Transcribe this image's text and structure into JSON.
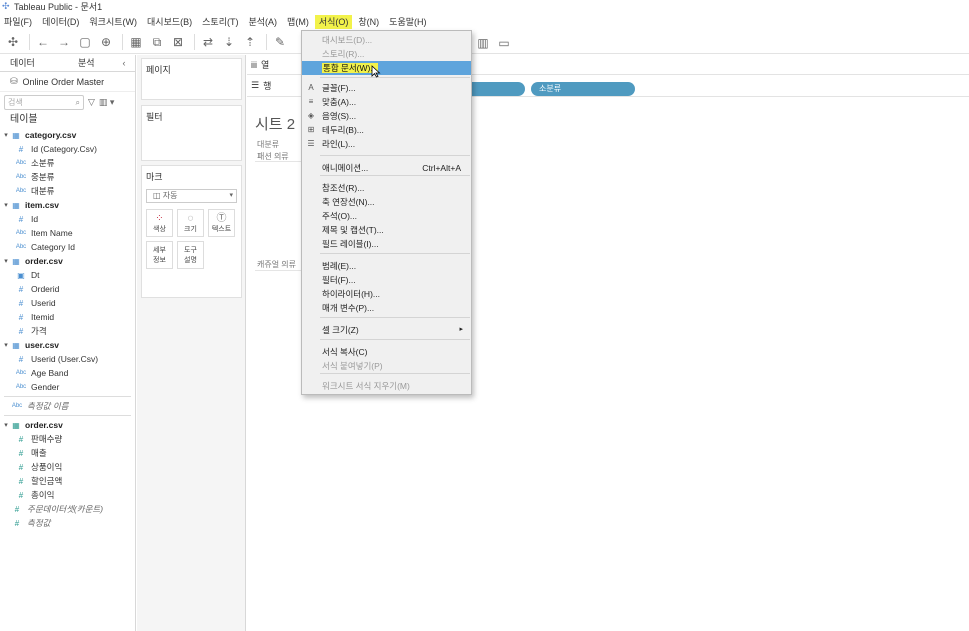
{
  "title": "Tableau Public - 문서1",
  "menus": [
    "파일(F)",
    "데이터(D)",
    "워크시트(W)",
    "대시보드(B)",
    "스토리(T)",
    "분석(A)",
    "맵(M)",
    "서식(O)",
    "창(N)",
    "도움말(H)"
  ],
  "left": {
    "tab_data": "데이터",
    "tab_analysis": "분석",
    "datasource": "Online Order Master",
    "search_placeholder": "검색",
    "tables_label": "테이블",
    "tree": [
      {
        "name": "category.csv",
        "level": 0,
        "type": "table"
      },
      {
        "name": "Id (Category.Csv)",
        "level": 1,
        "type": "num"
      },
      {
        "name": "소분류",
        "level": 1,
        "type": "abc"
      },
      {
        "name": "중분류",
        "level": 1,
        "type": "abc"
      },
      {
        "name": "대분류",
        "level": 1,
        "type": "abc"
      },
      {
        "name": "item.csv",
        "level": 0,
        "type": "table"
      },
      {
        "name": "Id",
        "level": 1,
        "type": "num"
      },
      {
        "name": "Item Name",
        "level": 1,
        "type": "abc"
      },
      {
        "name": "Category Id",
        "level": 1,
        "type": "abc"
      },
      {
        "name": "order.csv",
        "level": 0,
        "type": "table"
      },
      {
        "name": "Dt",
        "level": 1,
        "type": "cal"
      },
      {
        "name": "Orderid",
        "level": 1,
        "type": "num"
      },
      {
        "name": "Userid",
        "level": 1,
        "type": "num"
      },
      {
        "name": "Itemid",
        "level": 1,
        "type": "num"
      },
      {
        "name": "가격",
        "level": 1,
        "type": "num"
      },
      {
        "name": "user.csv",
        "level": 0,
        "type": "table"
      },
      {
        "name": "Userid (User.Csv)",
        "level": 1,
        "type": "num"
      },
      {
        "name": "Age Band",
        "level": 1,
        "type": "abc"
      },
      {
        "name": "Gender",
        "level": 1,
        "type": "abc"
      },
      {
        "name": "측정값 이름",
        "level": 0,
        "type": "abc-italic"
      },
      {
        "name": "order.csv",
        "level": 0,
        "type": "measure-table"
      },
      {
        "name": "판매수량",
        "level": 1,
        "type": "measure"
      },
      {
        "name": "매출",
        "level": 1,
        "type": "measure"
      },
      {
        "name": "상품이익",
        "level": 1,
        "type": "measure"
      },
      {
        "name": "할인금액",
        "level": 1,
        "type": "measure"
      },
      {
        "name": "총이익",
        "level": 1,
        "type": "measure"
      },
      {
        "name": "주문데이터셋(카운트)",
        "level": 0,
        "type": "measure-italic"
      },
      {
        "name": "측정값",
        "level": 0,
        "type": "measure-italic"
      }
    ]
  },
  "mid": {
    "pages": "페이지",
    "filters": "필터",
    "marks": "마크",
    "mark_type": "자동",
    "btn_color": "색상",
    "btn_size": "크기",
    "btn_text": "텍스트",
    "btn_detail_1": "세부",
    "btn_detail_2": "정보",
    "btn_tooltip_1": "도구",
    "btn_tooltip_2": "설명"
  },
  "canvas": {
    "columns_label": "열",
    "rows_label": "행",
    "row_pill": "소분류",
    "sheet_title": "시트 2",
    "hdr1": "대분류",
    "hdr2": "패션 의류",
    "hdr3": "캐쥬얼 의류"
  },
  "dropdown": [
    {
      "label": "대시보드(D)...",
      "disabled": true
    },
    {
      "label": "스토리(R)...",
      "disabled": true
    },
    {
      "label": "통합 문서(W)...",
      "highlight": true
    },
    {
      "label": "글꼴(F)...",
      "icon": "A"
    },
    {
      "label": "맞춤(A)...",
      "icon": "≡"
    },
    {
      "label": "음영(S)...",
      "icon": "◈"
    },
    {
      "label": "테두리(B)...",
      "icon": "⊞"
    },
    {
      "label": "라인(L)...",
      "icon": "☰"
    },
    {
      "label": "애니메이션...",
      "shortcut": "Ctrl+Alt+A"
    },
    {
      "label": "참조선(R)..."
    },
    {
      "label": "축 연장선(N)..."
    },
    {
      "label": "주석(O)..."
    },
    {
      "label": "제목 및 캡션(T)..."
    },
    {
      "label": "필드 레이블(I)..."
    },
    {
      "label": "범례(E)..."
    },
    {
      "label": "필터(F)..."
    },
    {
      "label": "하이라이터(H)..."
    },
    {
      "label": "매개 변수(P)..."
    },
    {
      "label": "셀 크기(Z)",
      "submenu": true
    },
    {
      "label": "서식 복사(C)"
    },
    {
      "label": "서식 붙여넣기(P)",
      "disabled": true
    },
    {
      "label": "워크시트 서식 지우기(M)",
      "disabled": true
    }
  ]
}
